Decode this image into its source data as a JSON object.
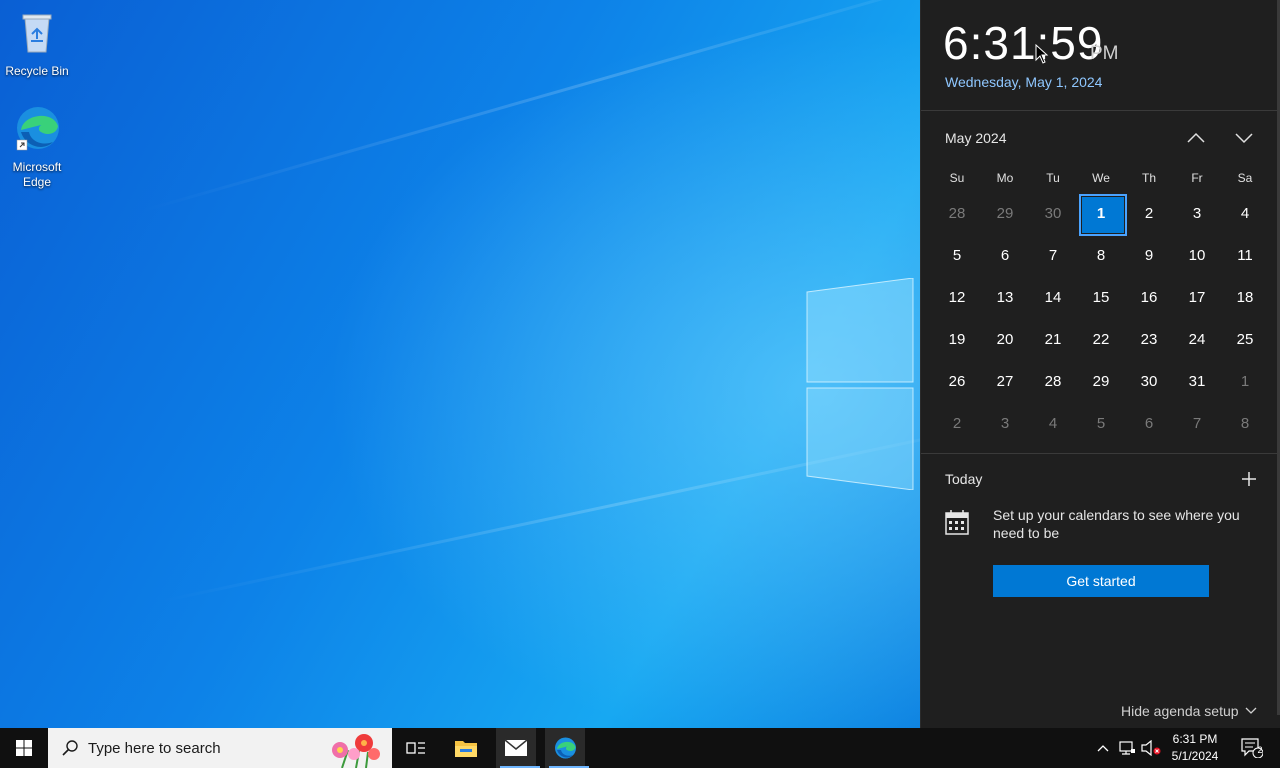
{
  "desktop": {
    "icons": [
      {
        "label": "Recycle Bin"
      },
      {
        "label": "Microsoft Edge"
      }
    ]
  },
  "flyout": {
    "time": "6:31:59",
    "ampm": "PM",
    "date_long": "Wednesday, May 1, 2024",
    "month_label": "May 2024",
    "weekdays": [
      "Su",
      "Mo",
      "Tu",
      "We",
      "Th",
      "Fr",
      "Sa"
    ],
    "days": [
      {
        "n": "28",
        "dim": true
      },
      {
        "n": "29",
        "dim": true
      },
      {
        "n": "30",
        "dim": true
      },
      {
        "n": "1",
        "today": true
      },
      {
        "n": "2"
      },
      {
        "n": "3"
      },
      {
        "n": "4"
      },
      {
        "n": "5"
      },
      {
        "n": "6"
      },
      {
        "n": "7"
      },
      {
        "n": "8"
      },
      {
        "n": "9"
      },
      {
        "n": "10"
      },
      {
        "n": "11"
      },
      {
        "n": "12"
      },
      {
        "n": "13"
      },
      {
        "n": "14"
      },
      {
        "n": "15"
      },
      {
        "n": "16"
      },
      {
        "n": "17"
      },
      {
        "n": "18"
      },
      {
        "n": "19"
      },
      {
        "n": "20"
      },
      {
        "n": "21"
      },
      {
        "n": "22"
      },
      {
        "n": "23"
      },
      {
        "n": "24"
      },
      {
        "n": "25"
      },
      {
        "n": "26"
      },
      {
        "n": "27"
      },
      {
        "n": "28"
      },
      {
        "n": "29"
      },
      {
        "n": "30"
      },
      {
        "n": "31"
      },
      {
        "n": "1",
        "dim": true
      },
      {
        "n": "2",
        "dim": true
      },
      {
        "n": "3",
        "dim": true
      },
      {
        "n": "4",
        "dim": true
      },
      {
        "n": "5",
        "dim": true
      },
      {
        "n": "6",
        "dim": true
      },
      {
        "n": "7",
        "dim": true
      },
      {
        "n": "8",
        "dim": true
      }
    ],
    "agenda": {
      "today_label": "Today",
      "message": "Set up your calendars to see where you need to be",
      "button_label": "Get started",
      "hide_label": "Hide agenda setup"
    }
  },
  "taskbar": {
    "search_placeholder": "Type here to search",
    "clock_time": "6:31 PM",
    "clock_date": "5/1/2024",
    "notification_count": "2"
  },
  "colors": {
    "accent": "#0078d4",
    "flyout_bg": "#1f1f1f",
    "taskbar_bg": "#101010",
    "date_link": "#8fc7ff"
  }
}
